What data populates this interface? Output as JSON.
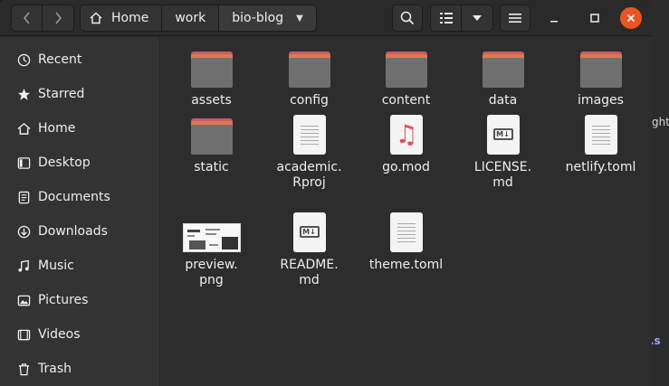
{
  "header": {
    "back_icon": "chevron-left-icon",
    "forward_icon": "chevron-right-icon",
    "path": [
      "Home",
      "work",
      "bio-blog"
    ]
  },
  "sidebar": {
    "items": [
      {
        "label": "Recent",
        "icon": "clock-icon"
      },
      {
        "label": "Starred",
        "icon": "star-icon"
      },
      {
        "label": "Home",
        "icon": "home-icon"
      },
      {
        "label": "Desktop",
        "icon": "desktop-icon"
      },
      {
        "label": "Documents",
        "icon": "document-icon"
      },
      {
        "label": "Downloads",
        "icon": "download-icon"
      },
      {
        "label": "Music",
        "icon": "music-icon"
      },
      {
        "label": "Pictures",
        "icon": "pictures-icon"
      },
      {
        "label": "Videos",
        "icon": "video-icon"
      },
      {
        "label": "Trash",
        "icon": "trash-icon"
      }
    ]
  },
  "files": [
    {
      "name": "assets",
      "type": "folder"
    },
    {
      "name": "config",
      "type": "folder"
    },
    {
      "name": "content",
      "type": "folder"
    },
    {
      "name": "data",
      "type": "folder"
    },
    {
      "name": "images",
      "type": "folder"
    },
    {
      "name": "static",
      "type": "folder"
    },
    {
      "name": "academic.\nRproj",
      "type": "text"
    },
    {
      "name": "go.mod",
      "type": "audio"
    },
    {
      "name": "LICENSE.\nmd",
      "type": "markdown"
    },
    {
      "name": "netlify.toml",
      "type": "text"
    },
    {
      "name": "preview.\npng",
      "type": "image"
    },
    {
      "name": "README.\nmd",
      "type": "markdown"
    },
    {
      "name": "theme.toml",
      "type": "text"
    }
  ],
  "background_window": {
    "fragment_1": "ght",
    "fragment_2": ".s"
  },
  "colors": {
    "accent": "#e95420",
    "folder_tab": "#e0784c",
    "folder_body": "#6f6f6f"
  }
}
